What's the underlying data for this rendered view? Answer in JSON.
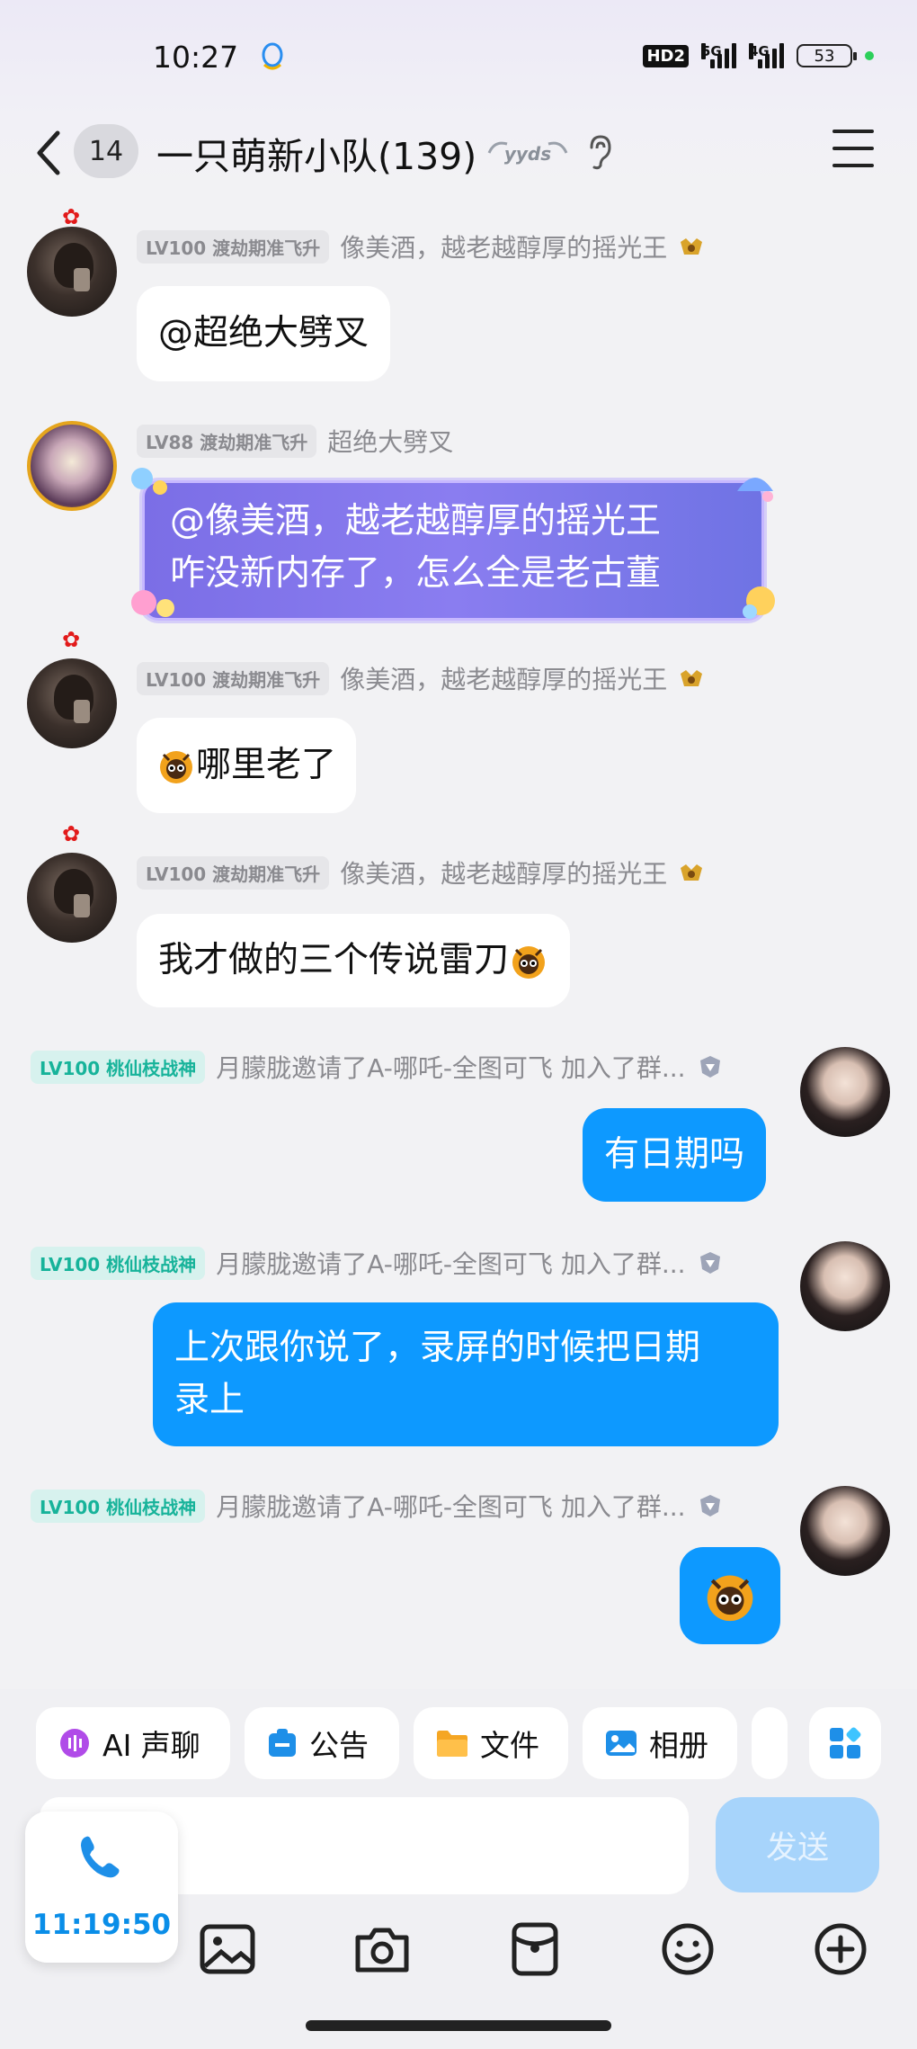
{
  "status_bar": {
    "time": "10:27",
    "hd_label": "HD2",
    "net_5g": "5G",
    "net_4g": "4G",
    "battery": "53"
  },
  "header": {
    "back_count": "14",
    "title": "一只萌新小队(139)",
    "badge_text": "yyds"
  },
  "messages": [
    {
      "side": "left",
      "level": "LV100 渡劫期准飞升",
      "nick": "像美酒，越老越醇厚的摇光王",
      "text": "@超绝大劈叉"
    },
    {
      "side": "left",
      "level": "LV88 渡劫期准飞升",
      "nick": "超绝大劈叉",
      "line1": "@像美酒，越老越醇厚的摇光王",
      "line2": "咋没新内存了，怎么全是老古董"
    },
    {
      "side": "left",
      "level": "LV100 渡劫期准飞升",
      "nick": "像美酒，越老越醇厚的摇光王",
      "text": "哪里老了"
    },
    {
      "side": "left",
      "level": "LV100 渡劫期准飞升",
      "nick": "像美酒，越老越醇厚的摇光王",
      "text": "我才做的三个传说雷刀"
    },
    {
      "side": "right",
      "level": "LV100 桃仙枝战神",
      "nick": "月朦胧邀请了A-哪吒-全图可飞 加入了群...",
      "text": "有日期吗"
    },
    {
      "side": "right",
      "level": "LV100 桃仙枝战神",
      "nick": "月朦胧邀请了A-哪吒-全图可飞 加入了群...",
      "line1": "上次跟你说了，录屏的时候把日期",
      "line2": "录上"
    },
    {
      "side": "right",
      "level": "LV100 桃仙枝战神",
      "nick": "月朦胧邀请了A-哪吒-全图可飞 加入了群...",
      "text": ""
    }
  ],
  "quick_actions": {
    "ai_voice": "AI 声聊",
    "notice": "公告",
    "files": "文件",
    "album": "相册"
  },
  "input": {
    "placeholder": "",
    "send_label": "发送"
  },
  "call": {
    "duration": "11:19:50"
  },
  "colors": {
    "accent": "#0d99ff",
    "level_teal": "#17b39a",
    "send_disabled": "#a7d4fb"
  }
}
